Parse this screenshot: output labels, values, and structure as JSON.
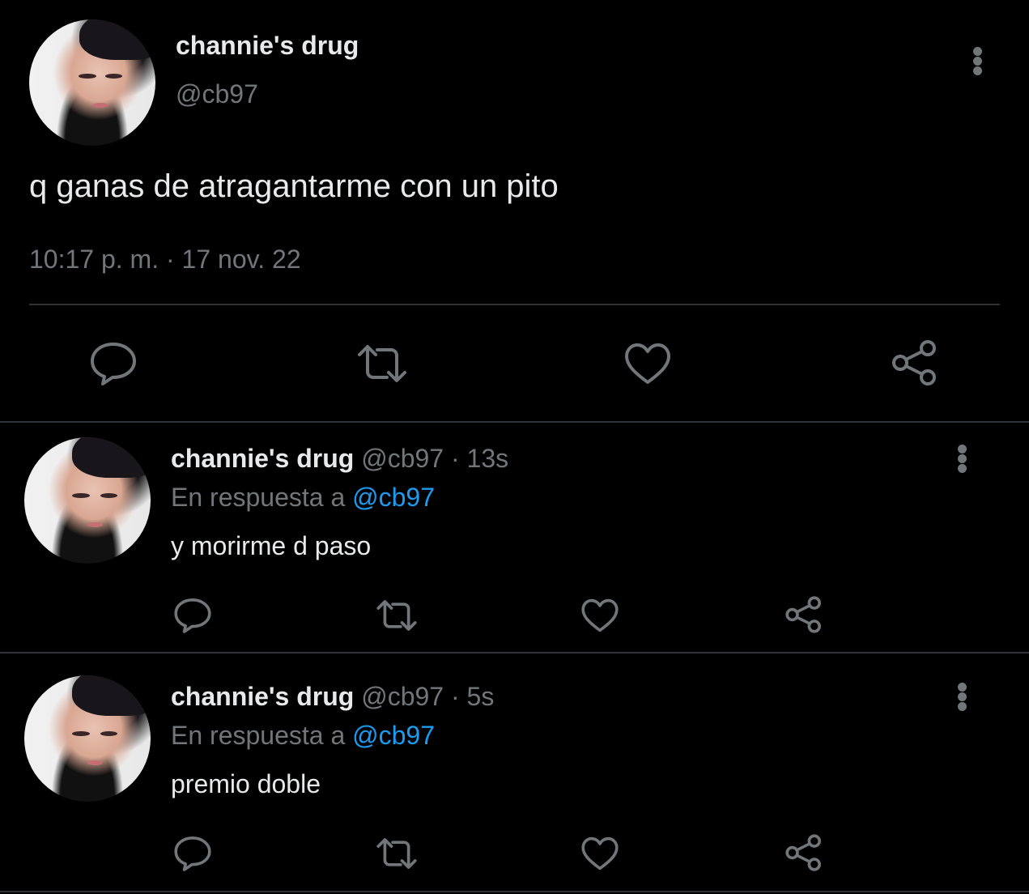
{
  "main_tweet": {
    "display_name": "channie's drug",
    "handle": "@cb97",
    "text": "q ganas de atragantarme con un pito",
    "timestamp": "10:17 p. m. · 17 nov. 22"
  },
  "replies": [
    {
      "display_name": "channie's drug",
      "handle": "@cb97",
      "age": "· 13s",
      "reply_prefix": "En respuesta a",
      "reply_to": "@cb97",
      "text": "y morirme d paso"
    },
    {
      "display_name": "channie's drug",
      "handle": "@cb97",
      "age": "· 5s",
      "reply_prefix": "En respuesta a",
      "reply_to": "@cb97",
      "text": "premio doble"
    }
  ],
  "icons": {
    "reply": "comment-icon",
    "retweet": "retweet-icon",
    "like": "heart-icon",
    "share": "share-icon",
    "menu": "more-options-icon"
  },
  "colors": {
    "background": "#000000",
    "text": "#e7e9ea",
    "muted": "#71767b",
    "link": "#1d9bf0",
    "divider": "#2f3336"
  }
}
